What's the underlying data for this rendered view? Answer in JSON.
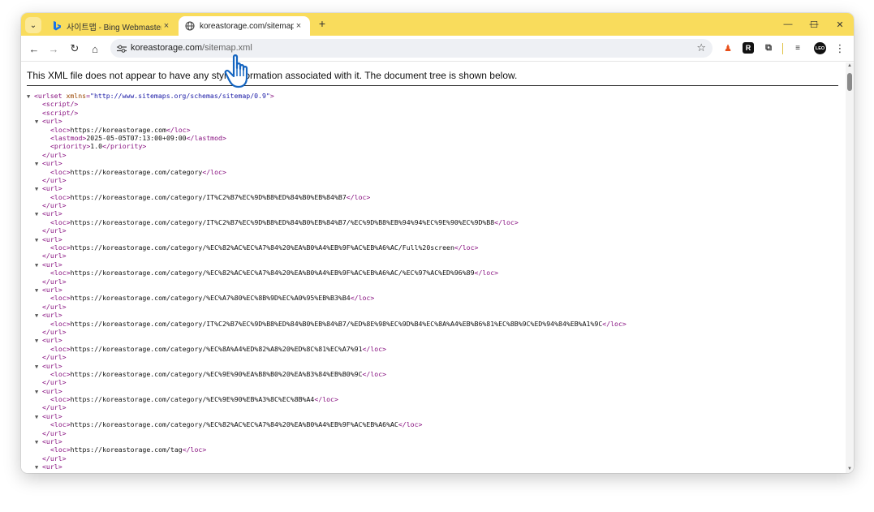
{
  "browser": {
    "tabs": [
      {
        "title": "사이트맵 - Bing Webmaster To",
        "close": "×",
        "active": false
      },
      {
        "title": "koreastorage.com/sitemap.xml",
        "close": "×",
        "active": true
      }
    ],
    "new_tab": "+",
    "window_controls": {
      "minimize": "—",
      "maximize": "☐",
      "close": "✕"
    }
  },
  "toolbar": {
    "back": "←",
    "forward": "→",
    "reload": "↻",
    "home": "⌂",
    "url_host": "koreastorage.com",
    "url_path": "/sitemap.xml",
    "bookmark": "☆",
    "menu": "⋮",
    "profile_badge": "LEO"
  },
  "colors": {
    "tabbar": "#f9dc5c",
    "tag": "#881280",
    "attr_name": "#994500",
    "attr_value": "#1a1aa6"
  },
  "page": {
    "banner": "This XML file does not appear to have any style information associated with it. The document tree is shown below.",
    "xml_lines": [
      {
        "i": 0,
        "f": true,
        "p": "<urlset",
        "a": "xmlns",
        "v": "\"http://www.sitemaps.org/schemas/sitemap/0.9\"",
        "s": ">"
      },
      {
        "i": 1,
        "p": "<script/>"
      },
      {
        "i": 1,
        "p": "<script/>"
      },
      {
        "i": 1,
        "f": true,
        "p": "<url>"
      },
      {
        "i": 2,
        "p": "<loc>",
        "t": "https://koreastorage.com",
        "s": "</loc>"
      },
      {
        "i": 2,
        "p": "<lastmod>",
        "t": "2025-05-05T07:13:00+09:00",
        "s": "</lastmod>"
      },
      {
        "i": 2,
        "p": "<priority>",
        "t": "1.0",
        "s": "</priority>"
      },
      {
        "i": 1,
        "p": "</url>"
      },
      {
        "i": 1,
        "f": true,
        "p": "<url>"
      },
      {
        "i": 2,
        "p": "<loc>",
        "t": "https://koreastorage.com/category",
        "s": "</loc>"
      },
      {
        "i": 1,
        "p": "</url>"
      },
      {
        "i": 1,
        "f": true,
        "p": "<url>"
      },
      {
        "i": 2,
        "p": "<loc>",
        "t": "https://koreastorage.com/category/IT%C2%B7%EC%9D%B8%ED%84%B0%EB%84%B7",
        "s": "</loc>"
      },
      {
        "i": 1,
        "p": "</url>"
      },
      {
        "i": 1,
        "f": true,
        "p": "<url>"
      },
      {
        "i": 2,
        "p": "<loc>",
        "t": "https://koreastorage.com/category/IT%C2%B7%EC%9D%B8%ED%84%B0%EB%84%B7/%EC%9D%B8%EB%94%94%EC%9E%90%EC%9D%B8",
        "s": "</loc>"
      },
      {
        "i": 1,
        "p": "</url>"
      },
      {
        "i": 1,
        "f": true,
        "p": "<url>"
      },
      {
        "i": 2,
        "p": "<loc>",
        "t": "https://koreastorage.com/category/%EC%82%AC%EC%A7%84%20%EA%B0%A4%EB%9F%AC%EB%A6%AC/Full%20screen",
        "s": "</loc>"
      },
      {
        "i": 1,
        "p": "</url>"
      },
      {
        "i": 1,
        "f": true,
        "p": "<url>"
      },
      {
        "i": 2,
        "p": "<loc>",
        "t": "https://koreastorage.com/category/%EC%82%AC%EC%A7%84%20%EA%B0%A4%EB%9F%AC%EB%A6%AC/%EC%97%AC%ED%96%89",
        "s": "</loc>"
      },
      {
        "i": 1,
        "p": "</url>"
      },
      {
        "i": 1,
        "f": true,
        "p": "<url>"
      },
      {
        "i": 2,
        "p": "<loc>",
        "t": "https://koreastorage.com/category/%EC%A7%80%EC%8B%9D%EC%A0%95%EB%B3%B4",
        "s": "</loc>"
      },
      {
        "i": 1,
        "p": "</url>"
      },
      {
        "i": 1,
        "f": true,
        "p": "<url>"
      },
      {
        "i": 2,
        "p": "<loc>",
        "t": "https://koreastorage.com/category/IT%C2%B7%EC%9D%B8%ED%84%B0%EB%84%B7/%ED%8E%98%EC%9D%B4%EC%8A%A4%EB%B6%81%EC%8B%9C%ED%94%84%EB%A1%9C",
        "s": "</loc>"
      },
      {
        "i": 1,
        "p": "</url>"
      },
      {
        "i": 1,
        "f": true,
        "p": "<url>"
      },
      {
        "i": 2,
        "p": "<loc>",
        "t": "https://koreastorage.com/category/%EC%8A%A4%ED%82%A8%20%ED%8C%81%EC%A7%91",
        "s": "</loc>"
      },
      {
        "i": 1,
        "p": "</url>"
      },
      {
        "i": 1,
        "f": true,
        "p": "<url>"
      },
      {
        "i": 2,
        "p": "<loc>",
        "t": "https://koreastorage.com/category/%EC%9E%90%EA%B8%B0%20%EA%B3%84%EB%B0%9C",
        "s": "</loc>"
      },
      {
        "i": 1,
        "p": "</url>"
      },
      {
        "i": 1,
        "f": true,
        "p": "<url>"
      },
      {
        "i": 2,
        "p": "<loc>",
        "t": "https://koreastorage.com/category/%EC%9E%90%EB%A3%8C%EC%8B%A4",
        "s": "</loc>"
      },
      {
        "i": 1,
        "p": "</url>"
      },
      {
        "i": 1,
        "f": true,
        "p": "<url>"
      },
      {
        "i": 2,
        "p": "<loc>",
        "t": "https://koreastorage.com/category/%EC%82%AC%EC%A7%84%20%EA%B0%A4%EB%9F%AC%EB%A6%AC",
        "s": "</loc>"
      },
      {
        "i": 1,
        "p": "</url>"
      },
      {
        "i": 1,
        "f": true,
        "p": "<url>"
      },
      {
        "i": 2,
        "p": "<loc>",
        "t": "https://koreastorage.com/tag",
        "s": "</loc>"
      },
      {
        "i": 1,
        "p": "</url>"
      },
      {
        "i": 1,
        "f": true,
        "p": "<url>"
      }
    ]
  }
}
